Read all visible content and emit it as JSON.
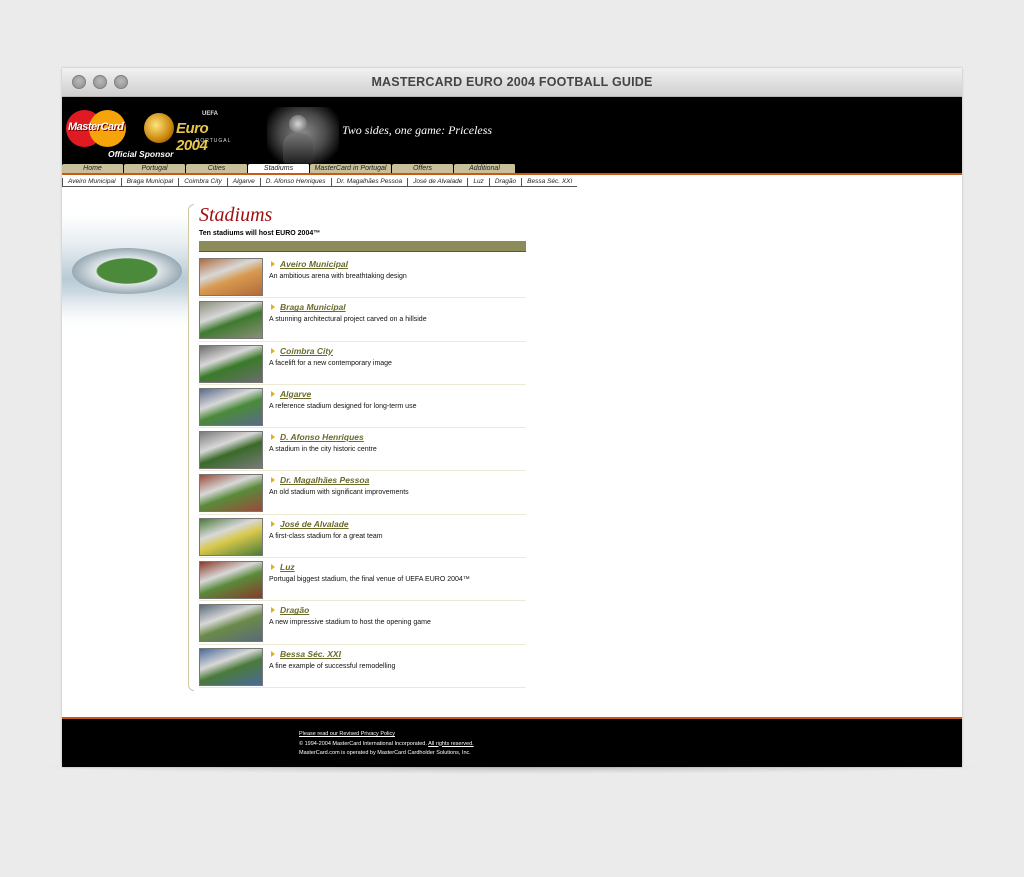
{
  "window": {
    "title": "MASTERCARD EURO 2004 FOOTBALL GUIDE"
  },
  "header": {
    "mastercard_text": "MasterCard",
    "sponsor": "Official Sponsor",
    "euro_text": "Euro 2004",
    "euro_sub": "UEFA",
    "euro_country": "PORTUGAL",
    "tagline": "Two sides, one game: Priceless"
  },
  "nav": {
    "tabs": [
      {
        "label": "Home",
        "width": 62
      },
      {
        "label": "Portugal",
        "width": 62
      },
      {
        "label": "Cities",
        "width": 62
      },
      {
        "label": "Stadiums",
        "width": 62
      },
      {
        "label": "MasterCard in Portugal",
        "width": 82
      },
      {
        "label": "Offers",
        "width": 62
      },
      {
        "label": "Additional",
        "width": 62
      }
    ],
    "active": "Stadiums",
    "sub_items": [
      "Aveiro Municipal",
      "Braga Municipal",
      "Coimbra City",
      "Algarve",
      "D. Afonso Henriques",
      "Dr. Magalhães Pessoa",
      "José de Alvalade",
      "Luz",
      "Dragão",
      "Bessa Séc. XXI"
    ]
  },
  "content": {
    "title": "Stadiums",
    "subtitle": "Ten stadiums will host EURO 2004™",
    "stadiums": [
      {
        "name": "Aveiro Municipal",
        "desc": "An ambitious arena with breathtaking design",
        "c1": "#b06a3a",
        "c2": "#d89a50"
      },
      {
        "name": "Braga Municipal",
        "desc": "A stunning architectural project carved on a hillside",
        "c1": "#8a8f7a",
        "c2": "#3f7a2f"
      },
      {
        "name": "Coimbra City",
        "desc": "A facelift for a new contemporary image",
        "c1": "#6c6c6c",
        "c2": "#3a7a2a"
      },
      {
        "name": "Algarve",
        "desc": "A reference stadium designed for long-term use",
        "c1": "#5a6a8a",
        "c2": "#4a8a3a"
      },
      {
        "name": "D. Afonso Henriques",
        "desc": "A stadium in the city historic centre",
        "c1": "#7a7a7a",
        "c2": "#3a6a2a"
      },
      {
        "name": "Dr. Magalhães Pessoa",
        "desc": "An old stadium with significant improvements",
        "c1": "#9a4a3a",
        "c2": "#5a8a3a"
      },
      {
        "name": "José de Alvalade",
        "desc": "A first-class stadium for a great team",
        "c1": "#4a7a3a",
        "c2": "#d8c84a"
      },
      {
        "name": "Luz",
        "desc": "Portugal biggest stadium, the final venue of UEFA EURO 2004™",
        "c1": "#8a3a2a",
        "c2": "#5a8a3a"
      },
      {
        "name": "Dragão",
        "desc": "A new impressive stadium to host the opening game",
        "c1": "#5a6a7a",
        "c2": "#6a8a4a"
      },
      {
        "name": "Bessa Séc. XXI",
        "desc": "A fine example of successful remodelling",
        "c1": "#4a6a9a",
        "c2": "#4a7a3a"
      }
    ]
  },
  "footer": {
    "privacy": "Please read our Revised Privacy Policy",
    "copyright": "© 1994-2004 MasterCard International Incorporated.",
    "rights": "All rights reserved.",
    "operated": "MasterCard.com is operated by MasterCard Cardholder Solutions, Inc."
  }
}
